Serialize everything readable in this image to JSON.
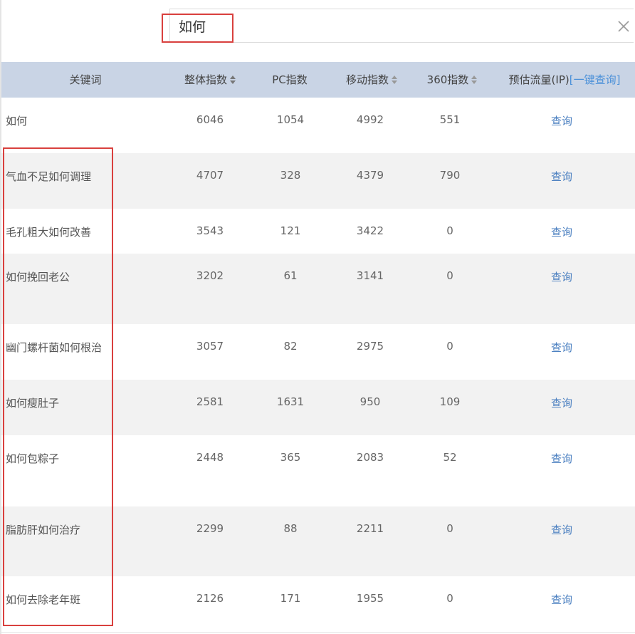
{
  "search": {
    "value": "如何"
  },
  "table": {
    "columns": [
      {
        "key": "keyword",
        "label": "关键词",
        "sortable": false
      },
      {
        "key": "overall",
        "label": "整体指数",
        "sortable": true
      },
      {
        "key": "pc",
        "label": "PC指数",
        "sortable": false
      },
      {
        "key": "mobile",
        "label": "移动指数",
        "sortable": true
      },
      {
        "key": "s360",
        "label": "360指数",
        "sortable": true
      },
      {
        "key": "traffic",
        "label": "预估流量(IP)",
        "link": "[一键查询]",
        "sortable": false
      }
    ],
    "action_label": "查询",
    "rows": [
      {
        "keyword": "如何",
        "overall": "6046",
        "pc": "1054",
        "mobile": "4992",
        "s360": "551"
      },
      {
        "keyword": "气血不足如何调理",
        "overall": "4707",
        "pc": "328",
        "mobile": "4379",
        "s360": "790"
      },
      {
        "keyword": "毛孔粗大如何改善",
        "overall": "3543",
        "pc": "121",
        "mobile": "3422",
        "s360": "0"
      },
      {
        "keyword": "如何挽回老公",
        "overall": "3202",
        "pc": "61",
        "mobile": "3141",
        "s360": "0"
      },
      {
        "keyword": "幽门螺杆菌如何根治",
        "overall": "3057",
        "pc": "82",
        "mobile": "2975",
        "s360": "0"
      },
      {
        "keyword": "如何瘦肚子",
        "overall": "2581",
        "pc": "1631",
        "mobile": "950",
        "s360": "109"
      },
      {
        "keyword": "如何包粽子",
        "overall": "2448",
        "pc": "365",
        "mobile": "2083",
        "s360": "52"
      },
      {
        "keyword": "脂肪肝如何治疗",
        "overall": "2299",
        "pc": "88",
        "mobile": "2211",
        "s360": "0"
      },
      {
        "keyword": "如何去除老年斑",
        "overall": "2126",
        "pc": "171",
        "mobile": "1955",
        "s360": "0"
      }
    ]
  },
  "colors": {
    "header_bg": "#c9d4e5",
    "alt_row_bg": "#f2f2f2",
    "link": "#4a7fc0",
    "highlight_border": "#d9403e"
  }
}
